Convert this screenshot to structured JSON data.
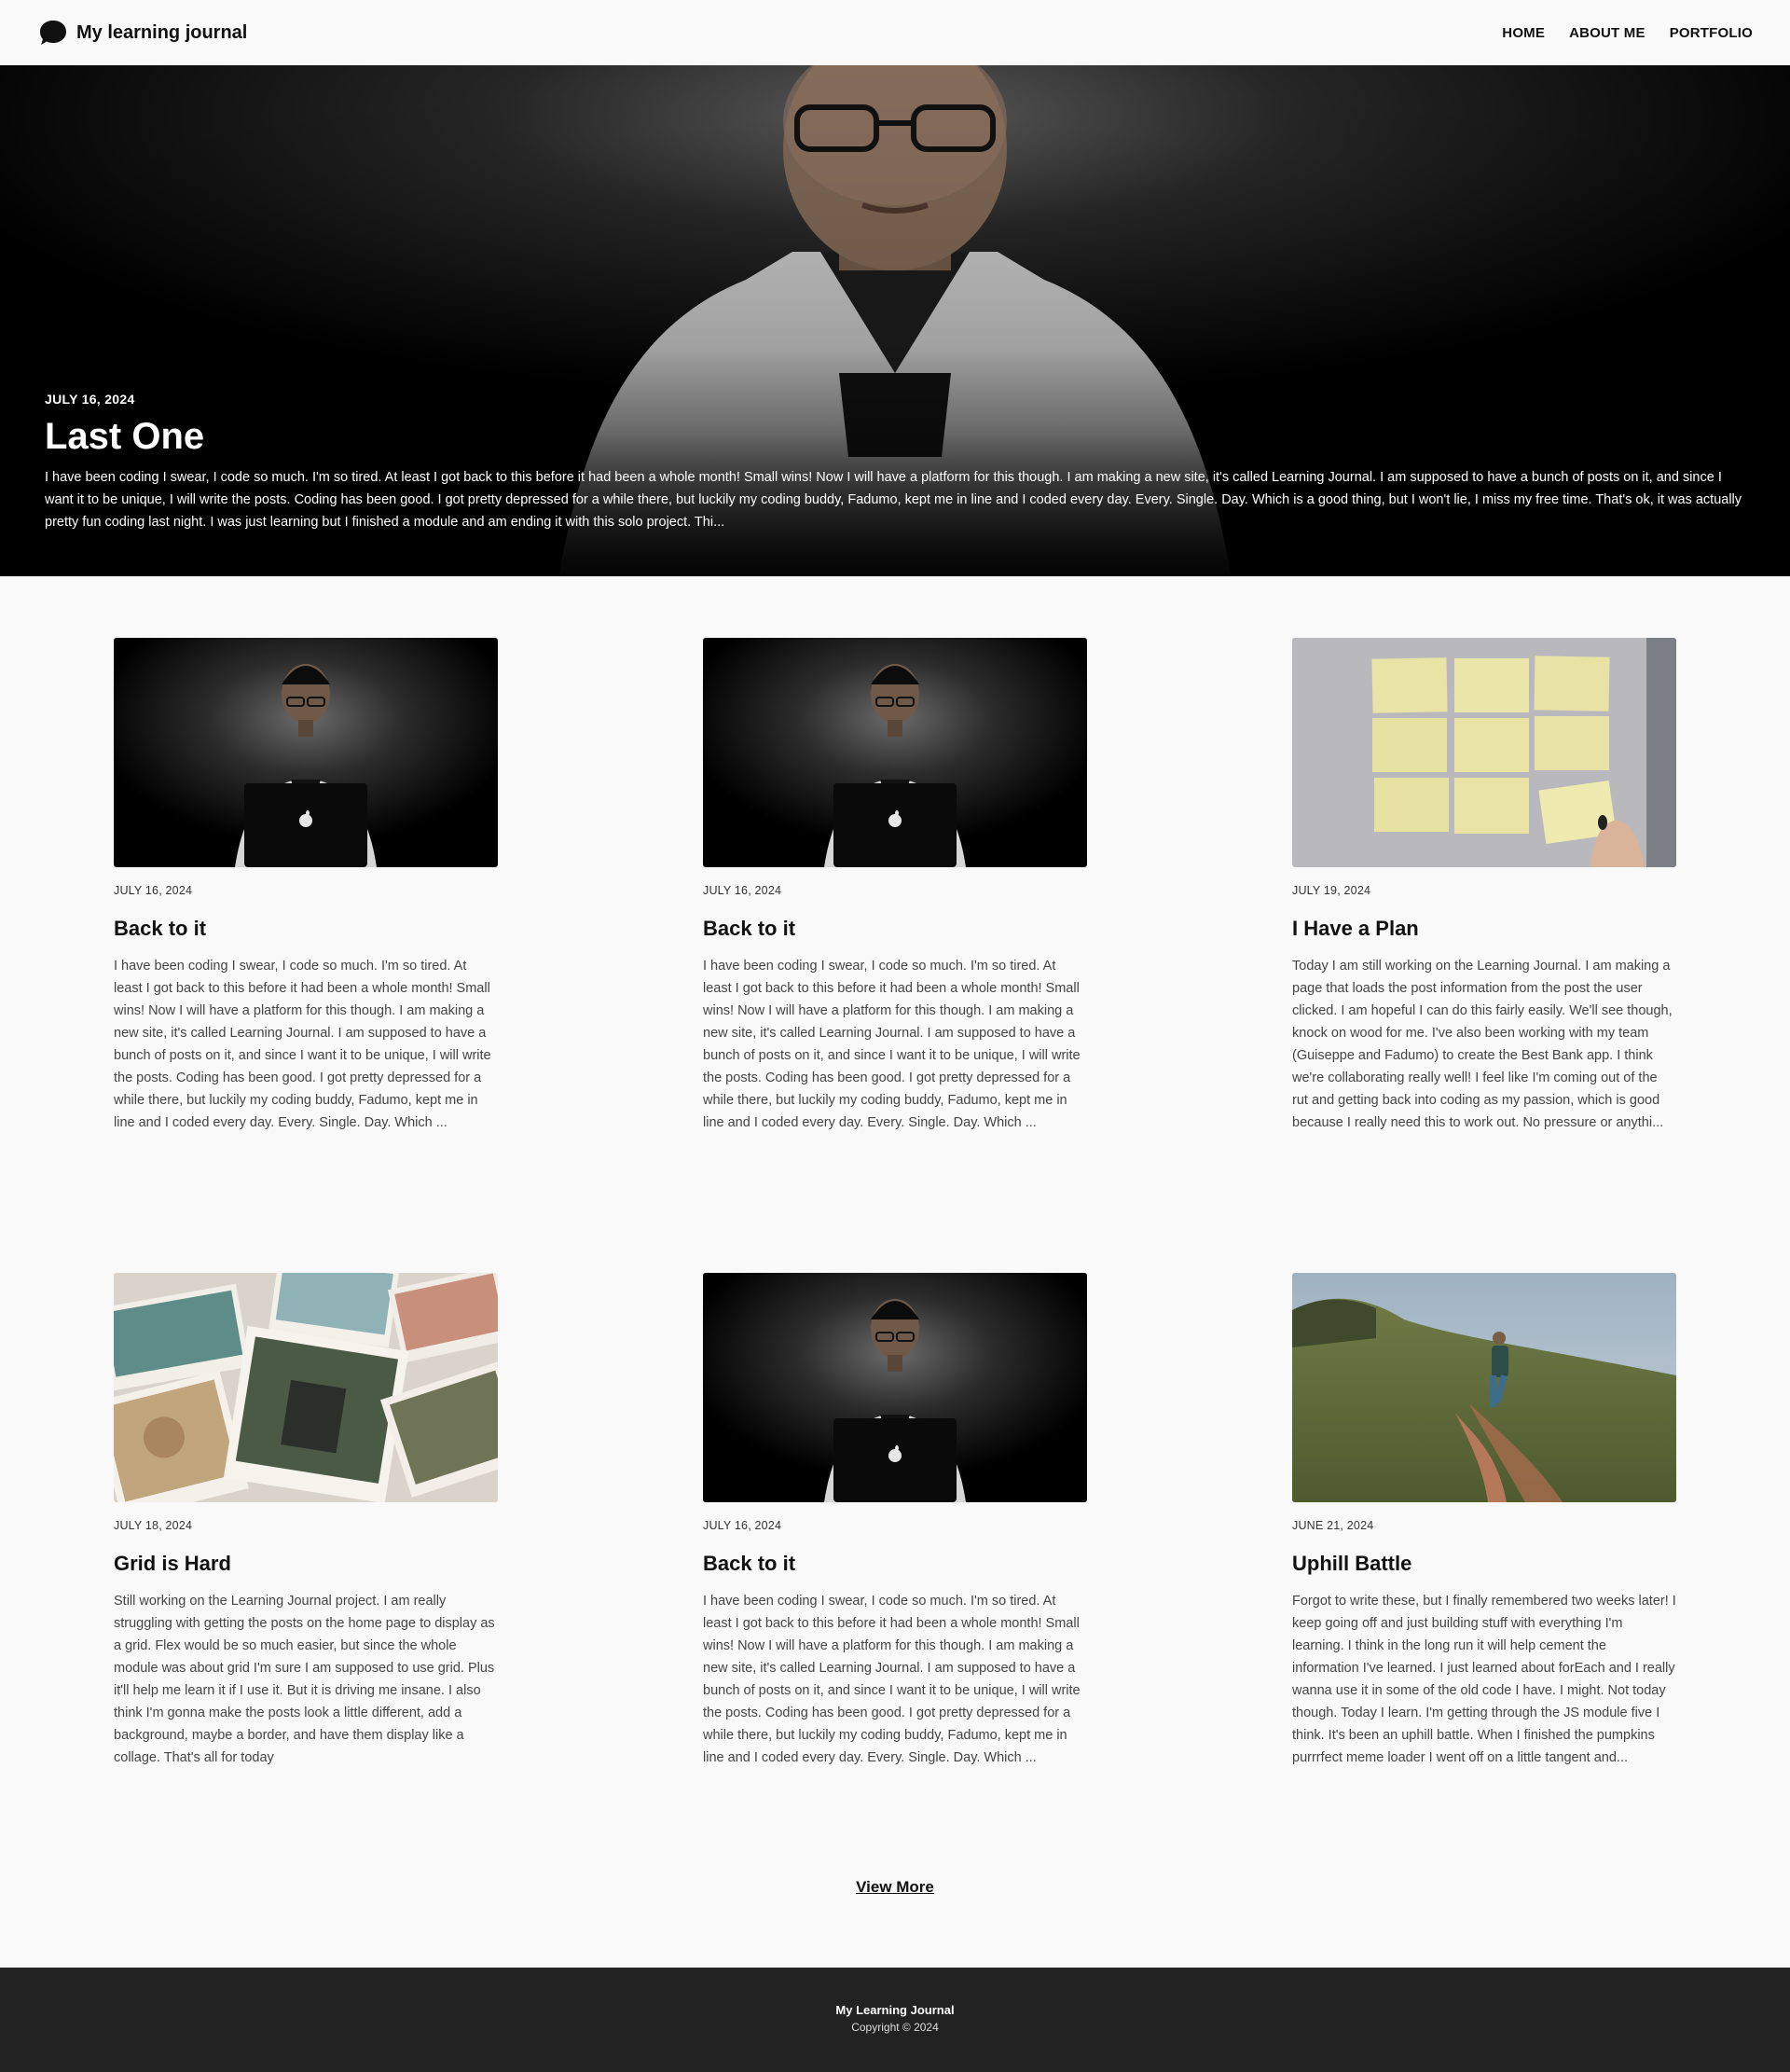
{
  "header": {
    "brand_title": "My learning journal",
    "nav": [
      {
        "label": "HOME"
      },
      {
        "label": "ABOUT ME"
      },
      {
        "label": "PORTFOLIO"
      }
    ]
  },
  "hero": {
    "date": "JULY 16, 2024",
    "title": "Last One",
    "excerpt": "I have been coding I swear, I code so much. I'm so tired. At least I got back to this before it had been a whole month! Small wins! Now I will have a platform for this though. I am making a new site, it's called Learning Journal. I am supposed to have a bunch of posts on it, and since I want it to be unique, I will write the posts. Coding has been good. I got pretty depressed for a while there, but luckily my coding buddy, Fadumo, kept me in line and I coded every day. Every. Single. Day. Which is a good thing, but I won't lie, I miss my free time. That's ok, it was actually pretty fun coding last night. I was just learning but I finished a module and am ending it with this solo project. Thi..."
  },
  "posts": [
    {
      "image": "man-at-laptop",
      "date": "JULY 16, 2024",
      "title": "Back to it",
      "excerpt": "I have been coding I swear, I code so much. I'm so tired. At least I got back to this before it had been a whole month! Small wins! Now I will have a platform for this though. I am making a new site, it's called Learning Journal. I am supposed to have a bunch of posts on it, and since I want it to be unique, I will write the posts. Coding has been good. I got pretty depressed for a while there, but luckily my coding buddy, Fadumo, kept me in line and I coded every day. Every. Single. Day. Which ..."
    },
    {
      "image": "man-at-laptop",
      "date": "JULY 16, 2024",
      "title": "Back to it",
      "excerpt": "I have been coding I swear, I code so much. I'm so tired. At least I got back to this before it had been a whole month! Small wins! Now I will have a platform for this though. I am making a new site, it's called Learning Journal. I am supposed to have a bunch of posts on it, and since I want it to be unique, I will write the posts. Coding has been good. I got pretty depressed for a while there, but luckily my coding buddy, Fadumo, kept me in line and I coded every day. Every. Single. Day. Which ..."
    },
    {
      "image": "sticky-notes",
      "date": "JULY 19, 2024",
      "title": "I Have a Plan",
      "excerpt": "Today I am still working on the Learning Journal. I am making a page that loads the post information from the post the user clicked. I am hopeful I can do this fairly easily. We'll see though, knock on wood for me. I've also been working with my team (Guiseppe and Fadumo) to create the Best Bank app. I think we're collaborating really well! I feel like I'm coming out of the rut and getting back into coding as my passion, which is good because I really need this to work out. No pressure or anythi..."
    },
    {
      "image": "scattered-photos",
      "date": "JULY 18, 2024",
      "title": "Grid is Hard",
      "excerpt": "Still working on the Learning Journal project. I am really struggling with getting the posts on the home page to display as a grid. Flex would be so much easier, but since the whole module was about grid I'm sure I am supposed to use grid. Plus it'll help me learn it if I use it. But it is driving me insane. I also think I'm gonna make the posts look a little different, add a background, maybe a border, and have them display like a collage. That's all for today"
    },
    {
      "image": "man-at-laptop",
      "date": "JULY 16, 2024",
      "title": "Back to it",
      "excerpt": "I have been coding I swear, I code so much. I'm so tired. At least I got back to this before it had been a whole month! Small wins! Now I will have a platform for this though. I am making a new site, it's called Learning Journal. I am supposed to have a bunch of posts on it, and since I want it to be unique, I will write the posts. Coding has been good. I got pretty depressed for a while there, but luckily my coding buddy, Fadumo, kept me in line and I coded every day. Every. Single. Day. Which ..."
    },
    {
      "image": "hiker-on-hill",
      "date": "JUNE 21, 2024",
      "title": "Uphill Battle",
      "excerpt": "Forgot to write these, but I finally remembered two weeks later! I keep going off and just building stuff with everything I'm learning. I think in the long run it will help cement the information I've learned. I just learned about forEach and I really wanna use it in some of the old code I have. I might. Not today though. Today I learn. I'm getting through the JS module five I think. It's been an uphill battle. When I finished the pumpkins purrrfect meme loader I went off on a little tangent and..."
    }
  ],
  "view_more_label": "View More",
  "footer": {
    "title": "My Learning Journal",
    "copyright": "Copyright © 2024"
  }
}
